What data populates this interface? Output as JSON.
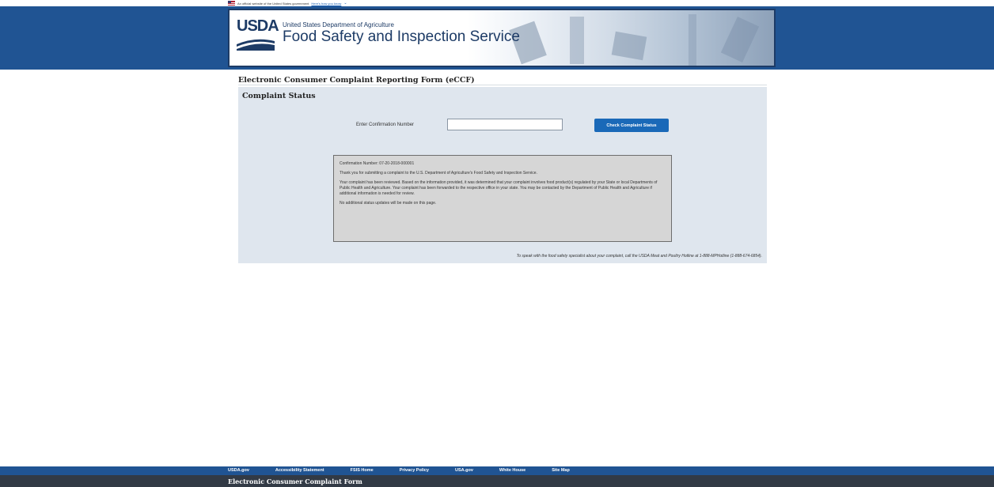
{
  "gov_banner": {
    "text": "An official website of the United States government",
    "link": "Here's how you know"
  },
  "header": {
    "logo_text": "USDA",
    "department": "United States Department of Agriculture",
    "agency": "Food Safety and Inspection Service"
  },
  "page": {
    "title": "Electronic Consumer Complaint Reporting Form (eCCF)"
  },
  "status": {
    "heading": "Complaint Status",
    "input_label": "Enter Confirmation Number",
    "input_value": "",
    "button_label": "Check Complaint Status"
  },
  "result": {
    "confirmation": "Confirmation Number: 07-20-2018-000001",
    "thanks": "Thank you for submitting a complaint to the U.S. Department of Agriculture's Food Safety and Inspection Service.",
    "reviewed": "Your complaint has been reviewed. Based on the information provided, it was determined that your complaint involves food product(s) regulated by your State or local Departments of Public Health and Agriculture. Your complaint has been forwarded to the respective office in your state. You may be contacted by the Department of Public Health and Agriculture if additional information is needed for review.",
    "no_updates": "No additional status updates will be made on this page."
  },
  "hotline": "To speak with the food safety specialist about your complaint, call the USDA Meat and Poultry Hotline at 1-888-MPHotline (1-888-674-6854).",
  "footer": {
    "links": [
      "USDA.gov",
      "Accessibility Statement",
      "FSIS Home",
      "Privacy Policy",
      "USA.gov",
      "White House",
      "Site Map"
    ],
    "title": "Electronic Consumer Complaint Form"
  }
}
